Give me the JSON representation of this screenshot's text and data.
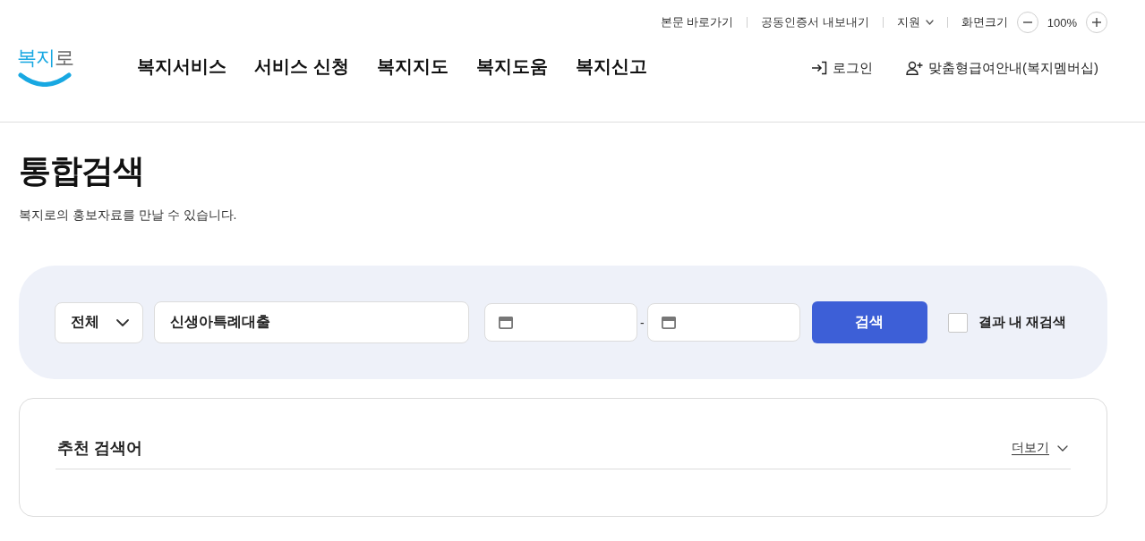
{
  "utility_bar": {
    "links": [
      {
        "label": "본문 바로가기",
        "kind": "link"
      },
      {
        "label": "공동인증서 내보내기",
        "kind": "link"
      },
      {
        "label": "지원",
        "kind": "dropdown"
      }
    ],
    "zoom": {
      "label": "화면크기",
      "value": "100%"
    }
  },
  "header": {
    "logo": {
      "text": "복지로"
    },
    "nav": [
      "복지서비스",
      "서비스 신청",
      "복지지도",
      "복지도움",
      "복지신고"
    ],
    "account_links": [
      {
        "label": "로그인",
        "kind": "login"
      },
      {
        "label": "맞춤형급여안내(복지멤버십)",
        "kind": "membership"
      }
    ]
  },
  "page": {
    "title": "통합검색",
    "subtitle": "복지로의 홍보자료를 만날 수 있습니다."
  },
  "search": {
    "category": "전체",
    "query": "신생아특례대출",
    "date_separator": "-",
    "button": "검색",
    "research": {
      "label": "결과 내 재검색",
      "checked": false
    }
  },
  "recommended": {
    "title": "추천 검색어",
    "more": "더보기"
  }
}
